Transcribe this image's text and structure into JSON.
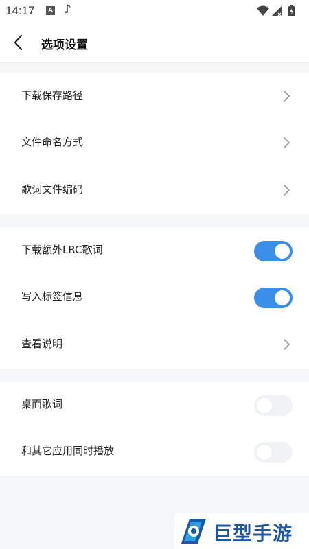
{
  "status_bar": {
    "time": "14:17",
    "a_badge": "A",
    "music_icon": "music-note-icon",
    "wifi_icon": "wifi-icon",
    "signal_icon": "signal-icon",
    "battery_icon": "battery-icon"
  },
  "header": {
    "back_icon": "chevron-left-icon",
    "title": "选项设置"
  },
  "group1": {
    "items": [
      {
        "label": "下载保存路径",
        "control": "chevron"
      },
      {
        "label": "文件命名方式",
        "control": "chevron"
      },
      {
        "label": "歌词文件编码",
        "control": "chevron"
      }
    ]
  },
  "group2": {
    "items": [
      {
        "label": "下载额外LRC歌词",
        "control": "toggle",
        "on": true
      },
      {
        "label": "写入标签信息",
        "control": "toggle",
        "on": true
      },
      {
        "label": "查看说明",
        "control": "chevron"
      }
    ]
  },
  "group3": {
    "items": [
      {
        "label": "桌面歌词",
        "control": "toggle",
        "on": false
      },
      {
        "label": "和其它应用同时播放",
        "control": "toggle",
        "on": false
      }
    ]
  },
  "watermark": {
    "text": "巨型手游网"
  },
  "colors": {
    "accent": "#3b8fe8",
    "background": "#f5f6f8",
    "watermark_blue": "#1e57a6"
  }
}
